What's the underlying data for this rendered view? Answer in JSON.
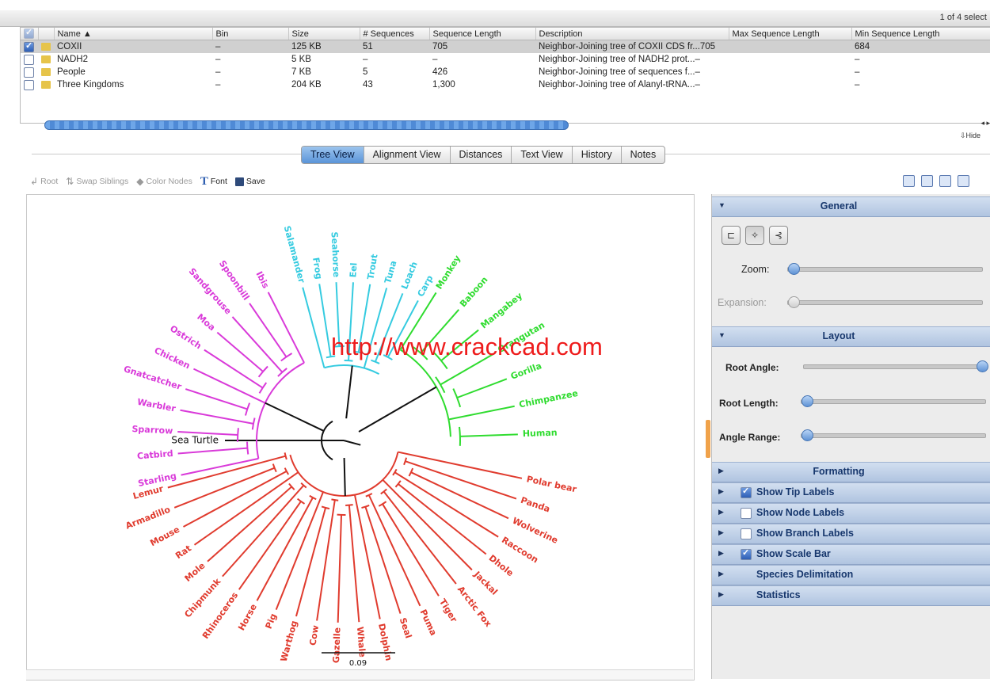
{
  "status": {
    "selection_count": "1 of 4 select"
  },
  "table": {
    "columns": [
      "Name ▲",
      "Bin",
      "Size",
      "# Sequences",
      "Sequence Length",
      "Description",
      "Max Sequence Length",
      "Min Sequence Length"
    ],
    "rows": [
      {
        "checked": true,
        "name": "COXII",
        "bin": "–",
        "size": "125 KB",
        "sequences": "51",
        "seq_length": "705",
        "description": "Neighbor-Joining tree of COXII CDS fr...705",
        "max_len": "",
        "min_len": "684"
      },
      {
        "checked": false,
        "name": "NADH2",
        "bin": "–",
        "size": "5 KB",
        "sequences": "–",
        "seq_length": "–",
        "description": "Neighbor-Joining tree of NADH2 prot...–",
        "max_len": "",
        "min_len": "–"
      },
      {
        "checked": false,
        "name": "People",
        "bin": "–",
        "size": "7 KB",
        "sequences": "5",
        "seq_length": "426",
        "description": "Neighbor-Joining tree of sequences f...–",
        "max_len": "",
        "min_len": "–"
      },
      {
        "checked": false,
        "name": "Three Kingdoms",
        "bin": "–",
        "size": "204 KB",
        "sequences": "43",
        "seq_length": "1,300",
        "description": "Neighbor-Joining tree of Alanyl-tRNA...–",
        "max_len": "",
        "min_len": "–"
      }
    ]
  },
  "scroll": {
    "arrows": "◂ ▸",
    "hide": "⇩Hide"
  },
  "tabs": [
    "Tree View",
    "Alignment View",
    "Distances",
    "Text View",
    "History",
    "Notes"
  ],
  "toolbar": {
    "root": "Root",
    "swap": "Swap Siblings",
    "color_nodes": "Color Nodes",
    "font": "Font",
    "save": "Save"
  },
  "watermark": "http://www.crackcad.com",
  "tree": {
    "colors": {
      "birds": "#d93ad9",
      "fish": "#35cbe0",
      "primates": "#2fdc2f",
      "mammals": "#e03b2e",
      "root": "#111111"
    },
    "root_label": "Sea Turtle",
    "scale_label": "0.09",
    "birds": [
      "Starling",
      "Catbird",
      "Sparrow",
      "Warbler",
      "Gnatcatcher",
      "Chicken",
      "Ostrich",
      "Moa",
      "Sandgrouse",
      "Spoonbill",
      "Ibis"
    ],
    "fish": [
      "Salamander",
      "Frog",
      "Seahorse",
      "Eel",
      "Trout",
      "Tuna",
      "Loach",
      "Carp"
    ],
    "primates": [
      "Monkey",
      "Baboon",
      "Mangabey",
      "Orangutan",
      "Gorilla",
      "Chimpanzee",
      "Human"
    ],
    "mammals": [
      "Polar bear",
      "Panda",
      "Wolverine",
      "Raccoon",
      "Dhole",
      "Jackal",
      "Arctic Fox",
      "Tiger",
      "Puma",
      "Seal",
      "Dolphin",
      "Whale",
      "Gazelle",
      "Cow",
      "Warthog",
      "Pig",
      "Horse",
      "Rhinoceros",
      "Chipmunk",
      "Mole",
      "Rat",
      "Mouse",
      "Armadillo",
      "Lemur"
    ]
  },
  "side": {
    "general": "General",
    "zoom": "Zoom:",
    "expansion": "Expansion:",
    "layout": "Layout",
    "root_angle": "Root Angle:",
    "root_length": "Root Length:",
    "angle_range": "Angle Range:",
    "formatting": "Formatting",
    "show_tip_labels": "Show Tip Labels",
    "show_node_labels": "Show Node Labels",
    "show_branch_labels": "Show Branch Labels",
    "show_scale_bar": "Show Scale Bar",
    "species_delimitation": "Species Delimitation",
    "statistics": "Statistics",
    "tip_labels_on": true,
    "node_labels_on": false,
    "branch_labels_on": false,
    "scale_bar_on": true,
    "zoom_level": 0.0,
    "expansion_level": 0.0,
    "root_angle_level": 1.0,
    "root_length_level": 0.0,
    "angle_range_level": 0.0
  }
}
